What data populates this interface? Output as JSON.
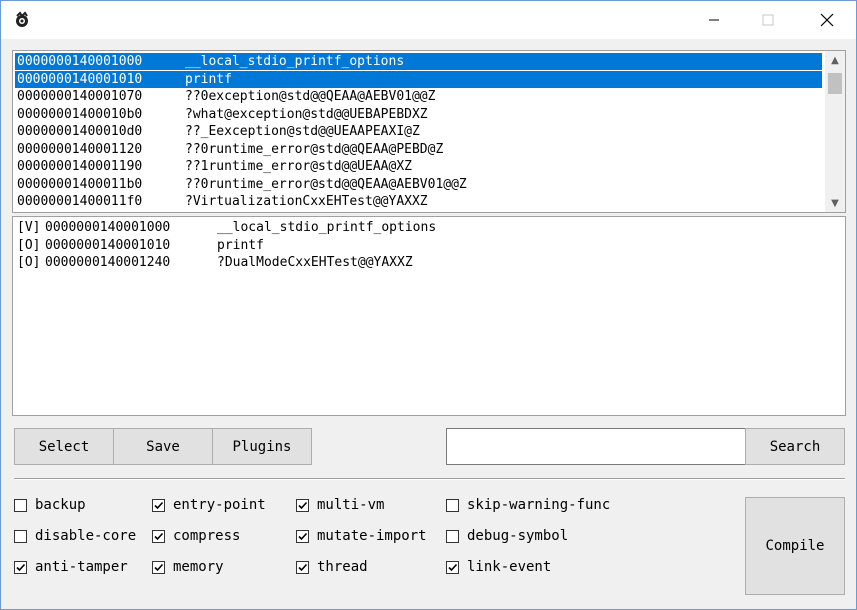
{
  "window": {
    "icon": "app-logo-icon",
    "controls": [
      "minimize-icon",
      "maximize-icon",
      "close-icon"
    ]
  },
  "function_list": {
    "rows": [
      {
        "address": "0000000140001000",
        "symbol": "__local_stdio_printf_options",
        "selected": true
      },
      {
        "address": "0000000140001010",
        "symbol": "printf",
        "selected": true
      },
      {
        "address": "0000000140001070",
        "symbol": "??0exception@std@@QEAA@AEBV01@@Z",
        "selected": false
      },
      {
        "address": "00000001400010b0",
        "symbol": "?what@exception@std@@UEBAPEBDXZ",
        "selected": false
      },
      {
        "address": "00000001400010d0",
        "symbol": "??_Eexception@std@@UEAAPEAXI@Z",
        "selected": false
      },
      {
        "address": "0000000140001120",
        "symbol": "??0runtime_error@std@@QEAA@PEBD@Z",
        "selected": false
      },
      {
        "address": "0000000140001190",
        "symbol": "??1runtime_error@std@@UEAA@XZ",
        "selected": false
      },
      {
        "address": "00000001400011b0",
        "symbol": "??0runtime_error@std@@QEAA@AEBV01@@Z",
        "selected": false
      },
      {
        "address": "00000001400011f0",
        "symbol": "?VirtualizationCxxEHTest@@YAXXZ",
        "selected": false
      }
    ],
    "scroll_up_icon": "chevron-up-icon",
    "scroll_down_icon": "chevron-down-icon"
  },
  "selected_list": {
    "rows": [
      {
        "tag": "[V]",
        "address": "0000000140001000",
        "symbol": "__local_stdio_printf_options"
      },
      {
        "tag": "[O]",
        "address": "0000000140001010",
        "symbol": "printf"
      },
      {
        "tag": "[O]",
        "address": "0000000140001240",
        "symbol": "?DualModeCxxEHTest@@YAXXZ"
      }
    ]
  },
  "buttons": {
    "select": "Select",
    "save": "Save",
    "plugins": "Plugins",
    "search": "Search",
    "compile": "Compile"
  },
  "search": {
    "value": "",
    "placeholder": ""
  },
  "options": [
    {
      "label": "backup",
      "checked": false
    },
    {
      "label": "entry-point",
      "checked": true
    },
    {
      "label": "multi-vm",
      "checked": true
    },
    {
      "label": "skip-warning-func",
      "checked": false
    },
    {
      "label": "disable-core",
      "checked": false
    },
    {
      "label": "compress",
      "checked": true
    },
    {
      "label": "mutate-import",
      "checked": true
    },
    {
      "label": "debug-symbol",
      "checked": false
    },
    {
      "label": "anti-tamper",
      "checked": true
    },
    {
      "label": "memory",
      "checked": true
    },
    {
      "label": "thread",
      "checked": true
    },
    {
      "label": "link-event",
      "checked": true
    }
  ],
  "colors": {
    "selection": "#0078d7",
    "window_border": "#6b9bd2"
  }
}
